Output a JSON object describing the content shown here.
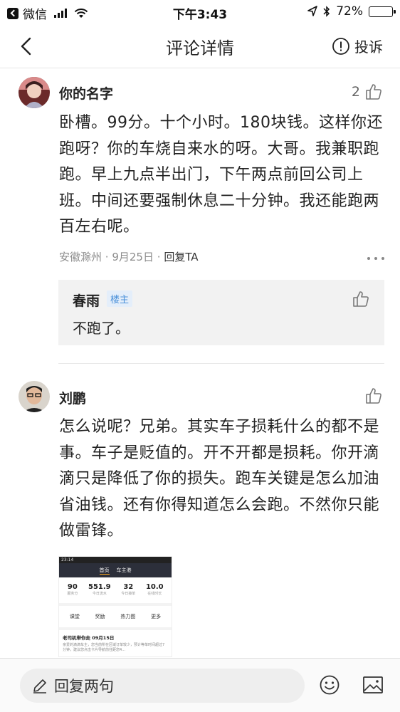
{
  "status_bar": {
    "carrier": "微信",
    "time": "下午3:43",
    "battery": "72%",
    "battery_level": 0.72
  },
  "nav": {
    "title": "评论详情",
    "report_label": "投诉"
  },
  "comments": [
    {
      "username": "你的名字",
      "likes": "2",
      "text": "卧槽。99分。十个小时。180块钱。这样你还跑呀？你的车烧自来水的呀。大哥。我兼职跑跑。早上九点半出门，下午两点前回公司上班。中间还要强制休息二十分钟。我还能跑两百左右呢。",
      "location": "安徽滁州",
      "date": "9月25日",
      "reply_label": "回复TA",
      "replies": [
        {
          "username": "春雨",
          "tag": "楼主",
          "text": "不跑了。"
        }
      ]
    },
    {
      "username": "刘鹏",
      "likes": "",
      "text": "怎么说呢？兄弟。其实车子损耗什么的都不是事。车子是贬值的。开不开都是损耗。你开滴滴只是降低了你的损失。跑车关键是怎么加油省油钱。还有你得知道怎么会跑。不然你只能做雷锋。",
      "attachment": {
        "status_time": "23:14",
        "tabs": [
          "首页",
          "车主港"
        ],
        "stats": [
          {
            "value": "90",
            "label": "服务分"
          },
          {
            "value": "551.9",
            "label": "今日流水"
          },
          {
            "value": "32",
            "label": "今日接单"
          },
          {
            "value": "10.0",
            "label": "在线时长"
          }
        ],
        "links": [
          "课堂",
          "奖励",
          "热力图",
          "更多"
        ],
        "news_title": "老司机带你走 09月15日",
        "news_text": "亲爱的滴滴车主，您当前所在区域订单较少，预计等单时间超过7分钟，建议您点击卡片导航前往距您4..."
      }
    }
  ],
  "bottom_bar": {
    "input_placeholder": "回复两句"
  }
}
